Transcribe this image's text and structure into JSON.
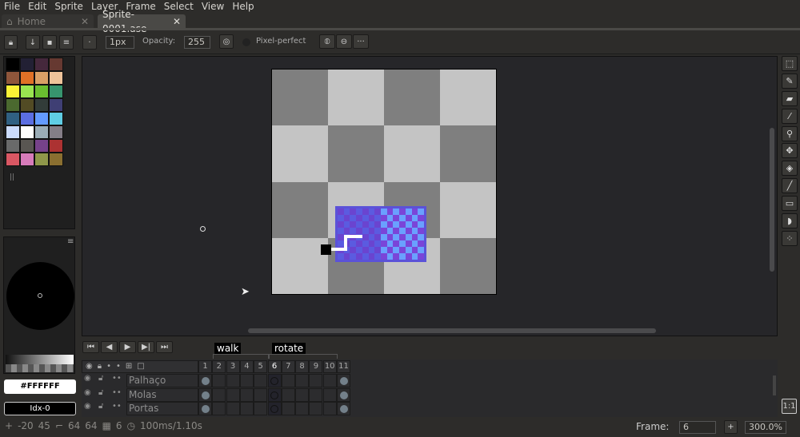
{
  "menu": [
    "File",
    "Edit",
    "Sprite",
    "Layer",
    "Frame",
    "Select",
    "View",
    "Help"
  ],
  "tabs": [
    {
      "label": "Home",
      "icon": "home-icon"
    },
    {
      "label": "Sprite-0001.ase",
      "active": true
    }
  ],
  "toolbar": {
    "brush_size": "1px",
    "opacity_label": "Opacity:",
    "opacity": "255",
    "pixel_perfect_label": "Pixel-perfect",
    "more": "···"
  },
  "palette": {
    "colors": [
      "#000000",
      "#222034",
      "#45283c",
      "#663931",
      "#8f563b",
      "#df7126",
      "#d9a066",
      "#eec39a",
      "#fbf236",
      "#99e550",
      "#6abe30",
      "#37946e",
      "#4b692f",
      "#524b24",
      "#323c39",
      "#3f3f74",
      "#306082",
      "#5b6ee1",
      "#639bff",
      "#5fcde4",
      "#cbdbfc",
      "#ffffff",
      "#9badb7",
      "#847e87",
      "#696a6a",
      "#595652",
      "#76428a",
      "#ac3232",
      "#d95763",
      "#d77bba",
      "#8f974a",
      "#8a6f30"
    ]
  },
  "color": {
    "fg_hex": "#FFFFFF",
    "index": "Idx-0"
  },
  "timeline": {
    "tags": [
      "walk",
      "rotate"
    ],
    "frames": [
      "1",
      "2",
      "3",
      "4",
      "5",
      "6",
      "7",
      "8",
      "9",
      "10",
      "11"
    ],
    "current_frame": 6,
    "layers": [
      {
        "name": "Palhaço"
      },
      {
        "name": "Molas"
      },
      {
        "name": "Portas"
      }
    ]
  },
  "status": {
    "pos_x": "-20",
    "pos_y": "45",
    "size_w": "64",
    "size_h": "64",
    "frame": "6",
    "duration": "100ms/1.10s",
    "frame_label": "Frame:",
    "frame_value": "6",
    "plus": "+",
    "zoom": "300.0%",
    "one_to_one": "1:1"
  }
}
